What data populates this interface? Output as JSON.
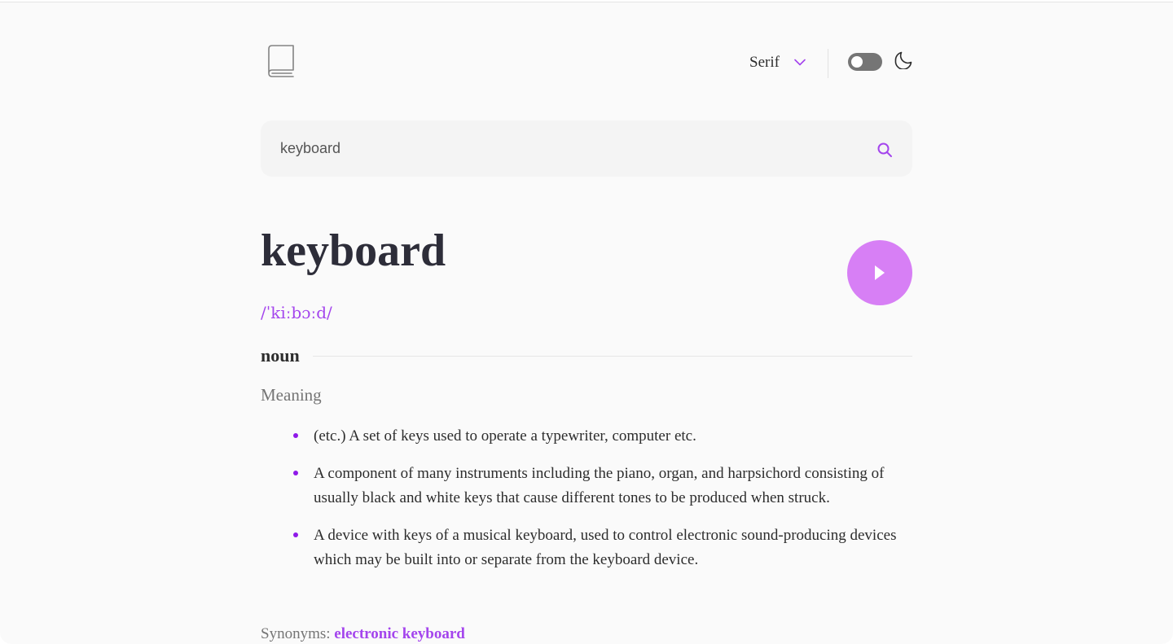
{
  "header": {
    "logo_icon": "book-icon",
    "font_select": {
      "selected": "Serif",
      "icon": "chevron-down-icon"
    },
    "theme_toggle": {
      "state": "off",
      "icon": "moon-icon"
    }
  },
  "search": {
    "value": "keyboard",
    "icon": "search-icon"
  },
  "entry": {
    "word": "keyboard",
    "phonetic": "/ˈkiːbɔːd/",
    "play_icon": "play-icon",
    "part_of_speech": "noun",
    "meaning_label": "Meaning",
    "definitions": [
      "(etc.) A set of keys used to operate a typewriter, computer etc.",
      "A component of many instruments including the piano, organ, and harpsichord consisting of usually black and white keys that cause different tones to be produced when struck.",
      "A device with keys of a musical keyboard, used to control electronic sound-producing devices which may be built into or separate from the keyboard device."
    ],
    "synonyms_label": "Synonyms:",
    "synonyms": "electronic keyboard"
  },
  "colors": {
    "accent": "#a445ed",
    "play_bg": "#d77ff5",
    "text": "#2d2d2d",
    "muted": "#757575"
  }
}
